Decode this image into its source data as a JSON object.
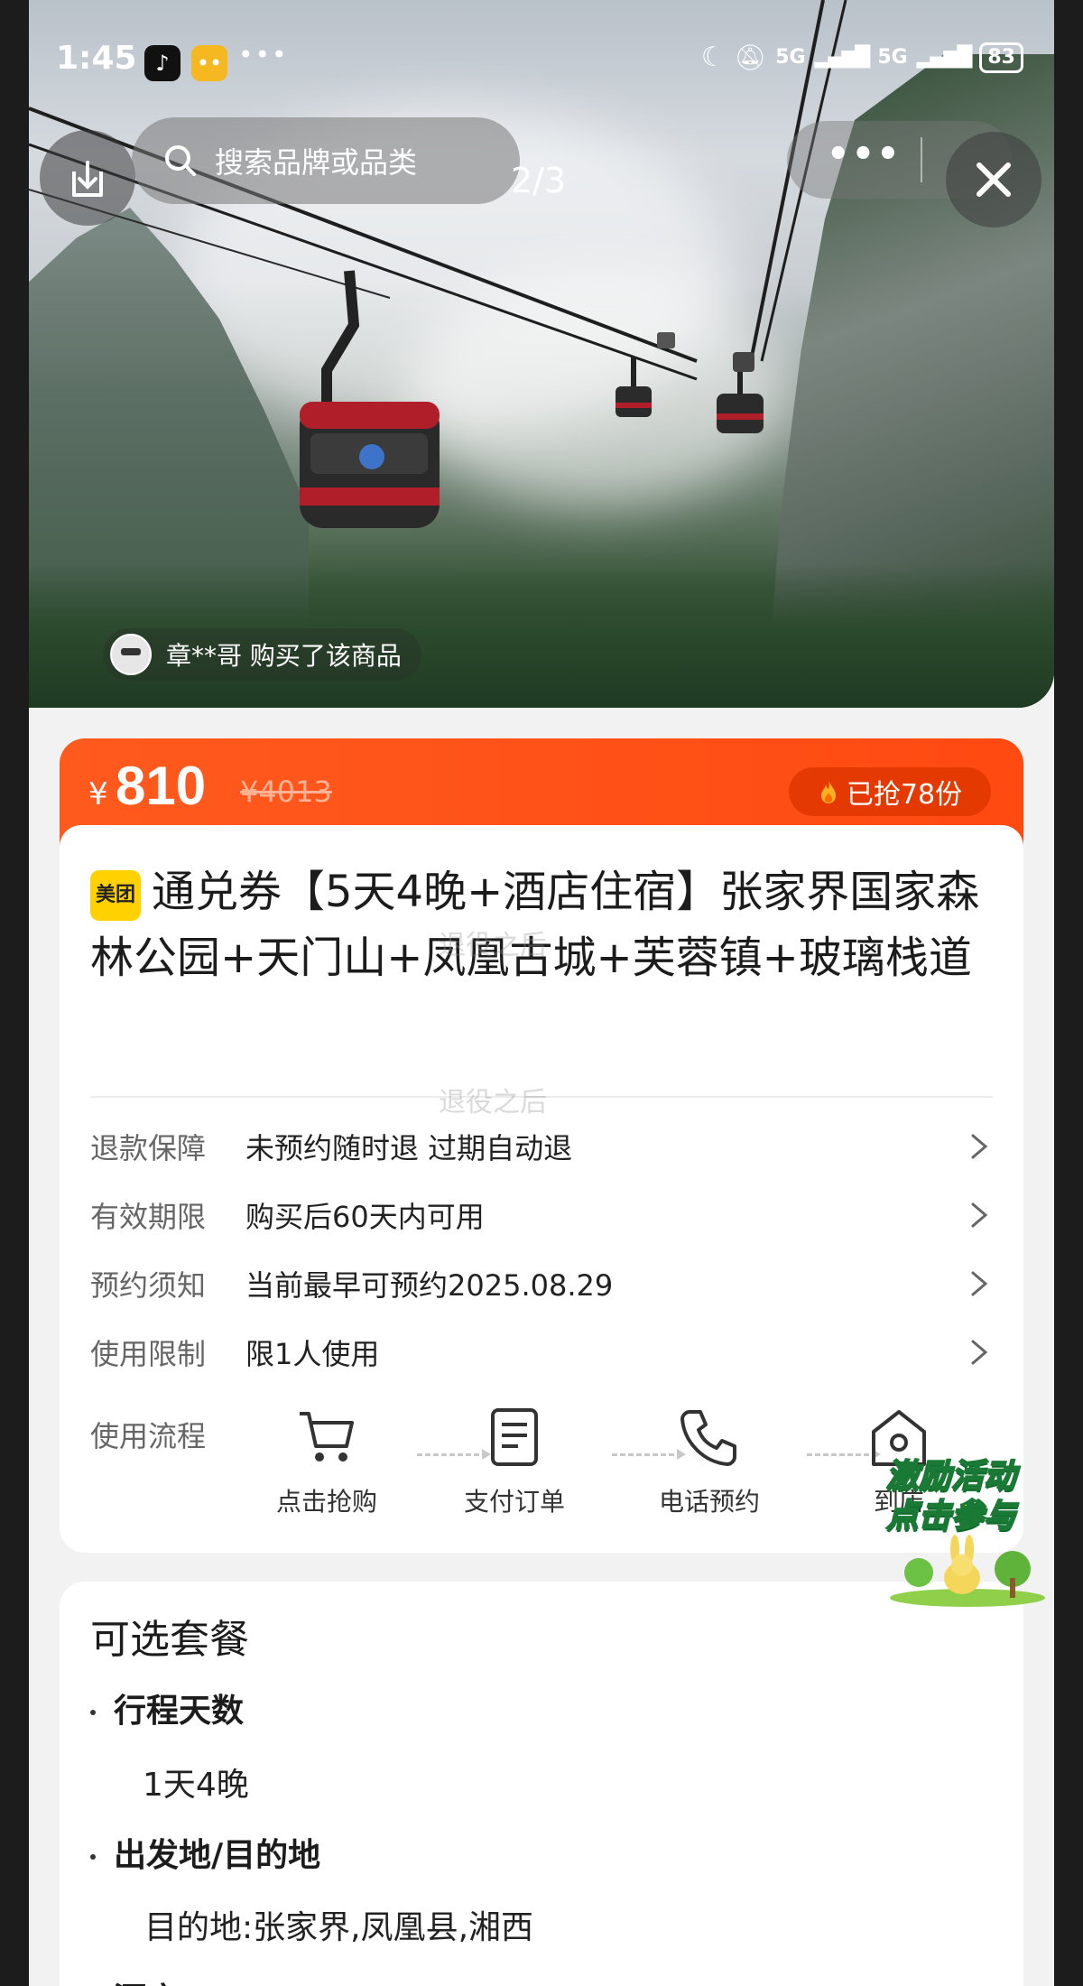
{
  "status_bar": {
    "time": "1:45",
    "battery": "83",
    "network": "5G"
  },
  "hero": {
    "search_placeholder": "搜索品牌或品类",
    "page_counter": "2/3",
    "buyer_notice": "章**哥 购买了该商品",
    "menu_dots": "•••"
  },
  "price": {
    "currency": "¥",
    "current": "810",
    "original": "¥4013",
    "sold": "已抢78份"
  },
  "product": {
    "brand_badge": "美团",
    "title": "通兑券【5天4晚+酒店住宿】张家界国家森林公园+天门山+凤凰古城+芙蓉镇+玻璃栈道"
  },
  "info_rows": [
    {
      "label": "退款保障",
      "value": "未预约随时退 过期自动退"
    },
    {
      "label": "有效期限",
      "value": "购买后60天内可用"
    },
    {
      "label": "预约须知",
      "value": "当前最早可预约2025.08.29"
    },
    {
      "label": "使用限制",
      "value": "限1人使用"
    }
  ],
  "process": {
    "label": "使用流程",
    "steps": [
      {
        "label": "点击抢购",
        "icon": "cart-icon"
      },
      {
        "label": "支付订单",
        "icon": "order-icon"
      },
      {
        "label": "电话预约",
        "icon": "phone-icon"
      },
      {
        "label": "到店",
        "icon": "store-icon"
      }
    ]
  },
  "promo": {
    "line1": "激励活动",
    "line2": "点击参与"
  },
  "watermark": "退役之后",
  "packages": {
    "heading": "可选套餐",
    "options": [
      {
        "title": "行程天数",
        "value": "1天4晚"
      },
      {
        "title": "出发地/目的地",
        "value": "目的地:张家界,凤凰县,湘西"
      },
      {
        "title": "酒店"
      }
    ]
  },
  "colors": {
    "accent_orange": "#ff4d15",
    "brand_yellow": "#ffd100",
    "promo_green": "#1a7a35"
  }
}
